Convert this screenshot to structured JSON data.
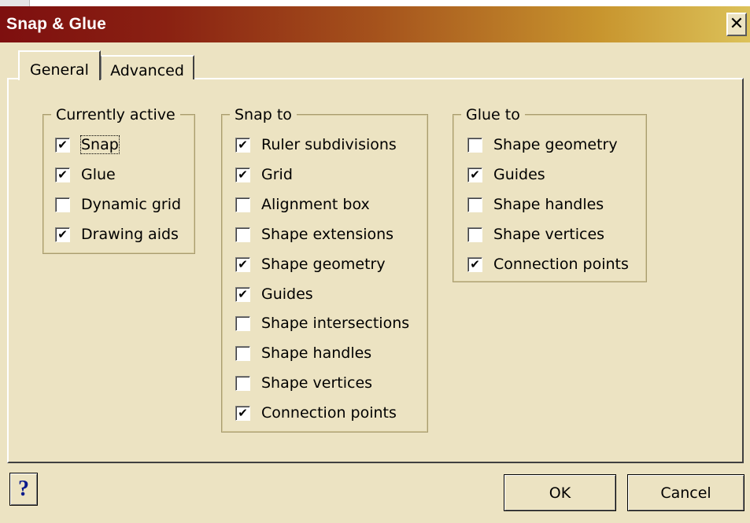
{
  "window": {
    "title": "Snap & Glue",
    "close_glyph": "✕"
  },
  "tabs": [
    {
      "label": "General",
      "selected": true
    },
    {
      "label": "Advanced",
      "selected": false
    }
  ],
  "groups": {
    "currently_active": {
      "title": "Currently active",
      "items": [
        {
          "label": "Snap",
          "checked": true
        },
        {
          "label": "Glue",
          "checked": true
        },
        {
          "label": "Dynamic grid",
          "checked": false
        },
        {
          "label": "Drawing aids",
          "checked": true
        }
      ]
    },
    "snap_to": {
      "title": "Snap to",
      "items": [
        {
          "label": "Ruler subdivisions",
          "checked": true
        },
        {
          "label": "Grid",
          "checked": true
        },
        {
          "label": "Alignment box",
          "checked": false
        },
        {
          "label": "Shape extensions",
          "checked": false
        },
        {
          "label": "Shape geometry",
          "checked": true
        },
        {
          "label": "Guides",
          "checked": true
        },
        {
          "label": "Shape intersections",
          "checked": false
        },
        {
          "label": "Shape handles",
          "checked": false
        },
        {
          "label": "Shape vertices",
          "checked": false
        },
        {
          "label": "Connection points",
          "checked": true
        }
      ]
    },
    "glue_to": {
      "title": "Glue to",
      "items": [
        {
          "label": "Shape geometry",
          "checked": false
        },
        {
          "label": "Guides",
          "checked": true
        },
        {
          "label": "Shape handles",
          "checked": false
        },
        {
          "label": "Shape vertices",
          "checked": false
        },
        {
          "label": "Connection points",
          "checked": true
        }
      ]
    }
  },
  "buttons": {
    "help": "?",
    "ok": "OK",
    "cancel": "Cancel"
  },
  "check_glyph": "✔",
  "colors": {
    "title_start": "#7e0f0f",
    "title_end": "#dcc25a",
    "face": "#ece3c2",
    "help_glyph": "#0a1a8c"
  }
}
